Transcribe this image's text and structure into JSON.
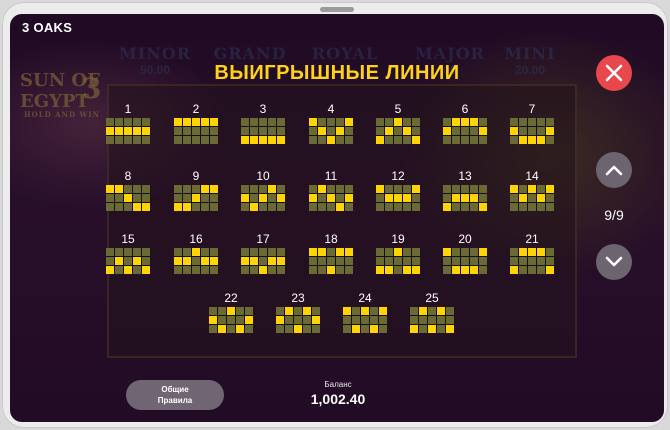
{
  "game": {
    "name": "3 OAKS",
    "logo": {
      "line1": "SUN OF EGYPT",
      "number": "3",
      "line3": "HOLD AND WIN"
    }
  },
  "jackpots": [
    {
      "name": "MINOR",
      "value": "50.00"
    },
    {
      "name": "GRAND",
      "value": "2"
    },
    {
      "name": "ROYAL",
      "value": ""
    },
    {
      "name": "MAJOR",
      "value": "00"
    },
    {
      "name": "MINI",
      "value": "20.00"
    }
  ],
  "paylines": {
    "title": "ВЫИГРЫШНЫЕ ЛИНИИ",
    "lines": [
      {
        "number": "1",
        "rows": [
          1,
          1,
          1,
          1,
          1
        ]
      },
      {
        "number": "2",
        "rows": [
          0,
          0,
          0,
          0,
          0
        ]
      },
      {
        "number": "3",
        "rows": [
          2,
          2,
          2,
          2,
          2
        ]
      },
      {
        "number": "4",
        "rows": [
          0,
          1,
          2,
          1,
          0
        ]
      },
      {
        "number": "5",
        "rows": [
          2,
          1,
          0,
          1,
          2
        ]
      },
      {
        "number": "6",
        "rows": [
          1,
          0,
          0,
          0,
          1
        ]
      },
      {
        "number": "7",
        "rows": [
          1,
          2,
          2,
          2,
          1
        ]
      },
      {
        "number": "8",
        "rows": [
          0,
          0,
          1,
          2,
          2
        ]
      },
      {
        "number": "9",
        "rows": [
          2,
          2,
          1,
          0,
          0
        ]
      },
      {
        "number": "10",
        "rows": [
          1,
          2,
          1,
          0,
          1
        ]
      },
      {
        "number": "11",
        "rows": [
          1,
          0,
          1,
          2,
          1
        ]
      },
      {
        "number": "12",
        "rows": [
          0,
          1,
          1,
          1,
          0
        ]
      },
      {
        "number": "13",
        "rows": [
          2,
          1,
          1,
          1,
          2
        ]
      },
      {
        "number": "14",
        "rows": [
          0,
          1,
          0,
          1,
          0
        ]
      },
      {
        "number": "15",
        "rows": [
          2,
          1,
          2,
          1,
          2
        ]
      },
      {
        "number": "16",
        "rows": [
          1,
          1,
          0,
          1,
          1
        ]
      },
      {
        "number": "17",
        "rows": [
          1,
          1,
          2,
          1,
          1
        ]
      },
      {
        "number": "18",
        "rows": [
          0,
          0,
          2,
          0,
          0
        ]
      },
      {
        "number": "19",
        "rows": [
          2,
          2,
          0,
          2,
          2
        ]
      },
      {
        "number": "20",
        "rows": [
          0,
          2,
          2,
          2,
          0
        ]
      },
      {
        "number": "21",
        "rows": [
          2,
          0,
          0,
          0,
          2
        ]
      },
      {
        "number": "22",
        "rows": [
          1,
          2,
          0,
          2,
          1
        ]
      },
      {
        "number": "23",
        "rows": [
          1,
          0,
          2,
          0,
          1
        ]
      },
      {
        "number": "24",
        "rows": [
          0,
          2,
          0,
          2,
          0
        ]
      },
      {
        "number": "25",
        "rows": [
          2,
          0,
          2,
          0,
          2
        ]
      }
    ]
  },
  "navigation": {
    "page_counter": "9/9",
    "close_icon": "close-x-icon",
    "up_icon": "chevron-up-icon",
    "down_icon": "chevron-down-icon"
  },
  "footer": {
    "rules_button_line1": "Общие",
    "rules_button_line2": "Правила",
    "balance_label": "Баланс",
    "balance_value": "1,002.40"
  },
  "colors": {
    "accent_yellow": "#ffd21a",
    "cell_on": "#ffd400",
    "cell_off": "#6b6a35",
    "close_red": "#e8474c",
    "nav_grey": "#6c6570"
  }
}
